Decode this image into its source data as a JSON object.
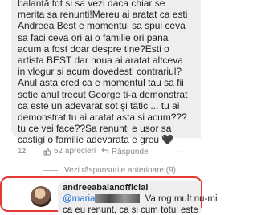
{
  "comment": {
    "text": "balanță tot si sa vezi daca chiar se\nmerita sa renunti!Mereu ai aratat ca esti\nAndreea Best e momentul sa spui ceva\nsa faci ceva ori ai o familie ori pana\nacum a fost doar despre tine?Esti o\nartista BEST dar noua ai aratat altceva\nin vlogur si acum dovedesti contrariul?\nAnul asta cred ca e momentul tau sa fii\nsotie anul trecut George ti-a demonstrat\nca este un adevarat sot și tătic ... tu ai\ndemonstrat tu ai aratat asta si acum???\ntu ce vei face??Sa renunti e usor sa\ncastigi o familie adevarata e greu 🖤",
    "time": "1z",
    "likes": "52 aprecieri",
    "reply_label": "Răspunde",
    "more": "..."
  },
  "thread": {
    "previous_replies": "Vezi răspunsurile anterioare (9)"
  },
  "reply": {
    "author": "andreeabalanofficial",
    "mention": "@maria",
    "line1_rest": " Va rog mult nu-mi",
    "line2": "ca eu renunt, ca si cum totul este",
    "line1_prefix_hidden": "",
    "line2_prefix": "nai trimiteti astfel de mesaje,"
  },
  "colors": {
    "highlight_border": "#e53935",
    "mention": "#1a6ed8"
  }
}
